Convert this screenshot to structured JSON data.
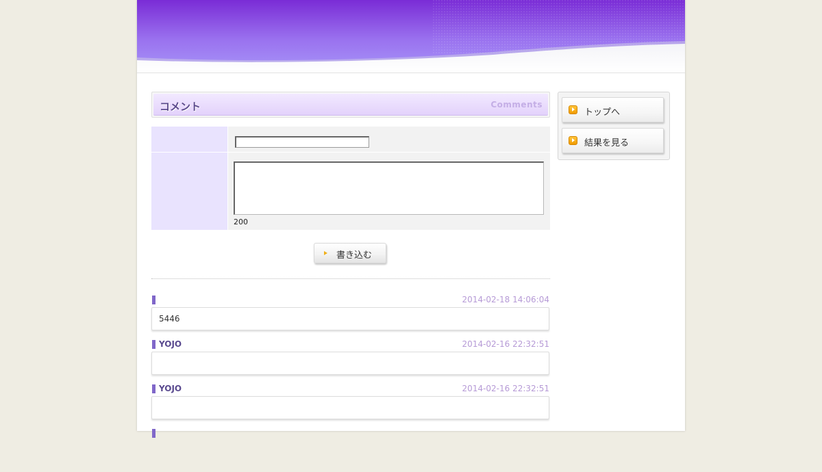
{
  "colors": {
    "accent": "#8067c9",
    "banner_top": "#7a2cd6",
    "banner_bottom": "#9e88f7",
    "date": "#b69ad6"
  },
  "section": {
    "title": "コメント",
    "subtitle": "Comments"
  },
  "form": {
    "name_value": "",
    "body_value": "",
    "max_length_note": "200",
    "submit_label": "書き込む",
    "submit_icon": "play-triangle-icon"
  },
  "comments": [
    {
      "name": "",
      "date": "2014-02-18 14:06:04",
      "text": "5446"
    },
    {
      "name": "YOJO",
      "date": "2014-02-16 22:32:51",
      "text": ""
    },
    {
      "name": "YOJO",
      "date": "2014-02-16 22:32:51",
      "text": ""
    },
    {
      "name": "",
      "date": "",
      "text": ""
    }
  ],
  "side_nav": [
    {
      "label": "トップへ",
      "icon": "orange-arrow-icon"
    },
    {
      "label": "結果を見る",
      "icon": "orange-arrow-icon"
    }
  ]
}
